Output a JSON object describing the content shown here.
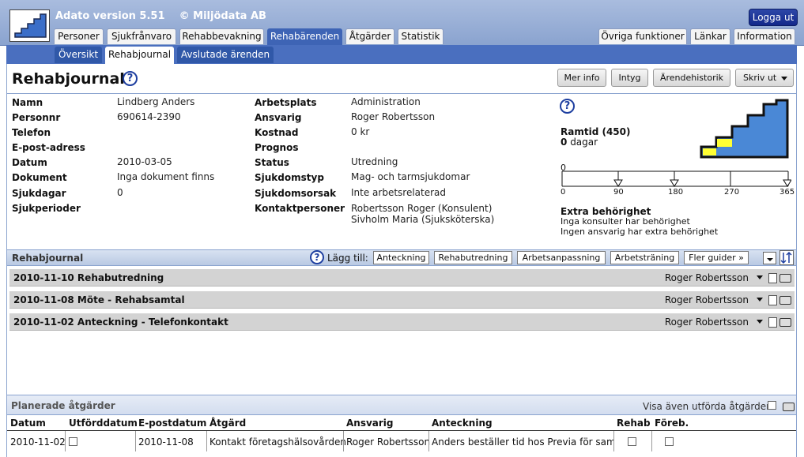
{
  "app": {
    "title": "Adato version 5.51",
    "copyright": "© Miljödata AB",
    "logout": "Logga ut"
  },
  "tabs": [
    "Personer",
    "Sjukfrånvaro",
    "Rehabbevakning",
    "Rehabärenden",
    "Åtgärder",
    "Statistik"
  ],
  "right_tabs": [
    "Övriga funktioner",
    "Länkar",
    "Information"
  ],
  "subtabs": [
    "Översikt",
    "Rehabjournal",
    "Avslutade ärenden"
  ],
  "page": {
    "title": "Rehabjournal"
  },
  "buttons": {
    "mer_info": "Mer info",
    "intyg": "Intyg",
    "arendehistorik": "Ärendehistorik",
    "skriv_ut": "Skriv ut"
  },
  "info_left": [
    {
      "label": "Namn",
      "value": "Lindberg Anders"
    },
    {
      "label": "Personnr",
      "value": "690614-2390"
    },
    {
      "label": "Telefon",
      "value": ""
    },
    {
      "label": "E-post-adress",
      "value": ""
    },
    {
      "label": "Datum",
      "value": "2010-03-05"
    },
    {
      "label": "Dokument",
      "value": "Inga dokument finns"
    },
    {
      "label": "Sjukdagar",
      "value": "0"
    },
    {
      "label": "Sjukperioder",
      "value": ""
    }
  ],
  "info_mid": [
    {
      "label": "Arbetsplats",
      "value": "Administration"
    },
    {
      "label": "Ansvarig",
      "value": "Roger Robertsson"
    },
    {
      "label": "Kostnad",
      "value": "0 kr"
    },
    {
      "label": "Prognos",
      "value": ""
    },
    {
      "label": "Status",
      "value": "Utredning"
    },
    {
      "label": "Sjukdomstyp",
      "value": "Mag- och tarmsjukdomar"
    },
    {
      "label": "Sjukdomsorsak",
      "value": "Inte arbetsrelaterad"
    },
    {
      "label": "Kontaktpersoner",
      "value": "Robertsson Roger (Konsulent)"
    }
  ],
  "contact_extra": "Sivholm Maria (Sjuksköterska)",
  "ramtid": {
    "title": "Ramtid (450)",
    "days_num": "0",
    "days_label": "dagar",
    "zero_label": "0",
    "ticks": [
      "0",
      "90",
      "180",
      "270",
      "365"
    ]
  },
  "extra": {
    "title": "Extra behörighet",
    "line1": "Inga konsulter har behörighet",
    "line2": "Ingen ansvarig har extra behörighet"
  },
  "journal": {
    "title": "Rehabjournal",
    "add_label": "Lägg till:",
    "add_buttons": [
      "Anteckning",
      "Rehabutredning",
      "Arbetsanpassning",
      "Arbetsträning",
      "Fler guider »"
    ],
    "rows": [
      {
        "title": "2010-11-10  Rehabutredning",
        "person": "Roger Robertsson"
      },
      {
        "title": "2010-11-08  Möte - Rehabsamtal",
        "person": "Roger Robertsson"
      },
      {
        "title": "2010-11-02  Anteckning - Telefonkontakt",
        "person": "Roger Robertsson"
      }
    ]
  },
  "planned": {
    "title": "Planerade åtgärder",
    "show_done_label": "Visa även utförda åtgärder",
    "headers": [
      "Datum",
      "Utförddatum",
      "E-postdatum",
      "Åtgärd",
      "Ansvarig",
      "Anteckning",
      "Rehab",
      "Föreb."
    ],
    "row": {
      "datum": "2010-11-02",
      "epost": "2010-11-08",
      "atgard": "Kontakt företagshälsovården",
      "ansvarig": "Roger Robertsson",
      "anteckning": "Anders beställer tid hos Previa för samt"
    }
  }
}
